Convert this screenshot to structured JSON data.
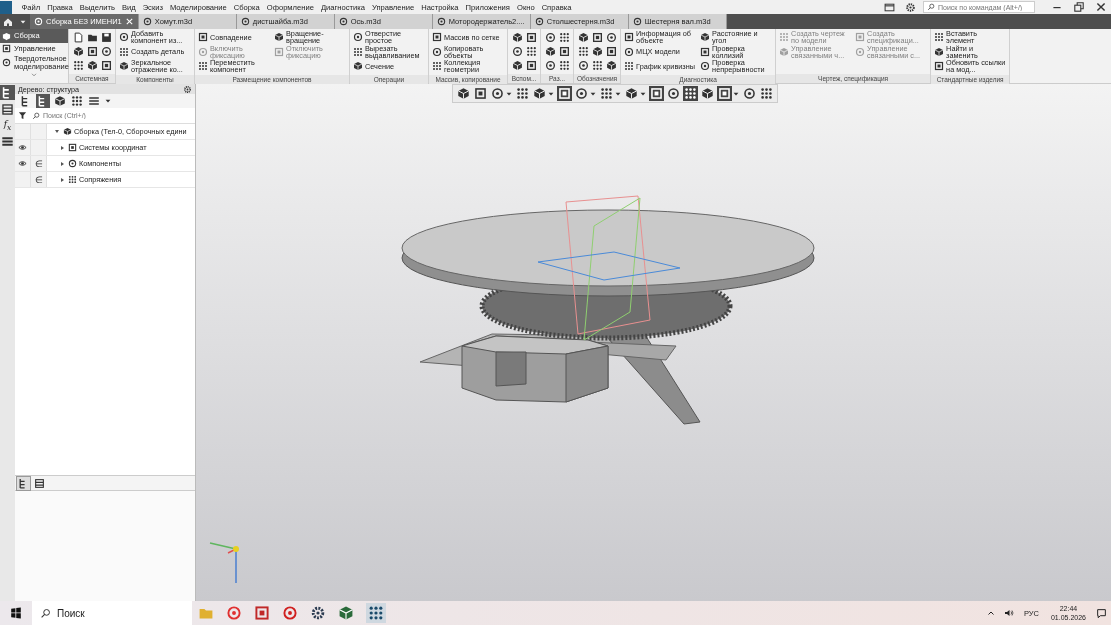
{
  "app_menu": [
    "Файл",
    "Правка",
    "Выделить",
    "Вид",
    "Эскиз",
    "Моделирование",
    "Сборка",
    "Оформление",
    "Диагностика",
    "Управление",
    "Настройка",
    "Приложения",
    "Окно",
    "Справка"
  ],
  "command_search": {
    "placeholder": "Поиск по командам (Alt+/)"
  },
  "document_tabs": [
    {
      "label": "Сборка БЕЗ ИМЕНИ1",
      "selected": true
    },
    {
      "label": "Хомут.m3d",
      "selected": false
    },
    {
      "label": "дистшайба.m3d",
      "selected": false
    },
    {
      "label": "Ось.m3d",
      "selected": false
    },
    {
      "label": "Мотородержатель2....",
      "selected": false
    },
    {
      "label": "Столшестерня.m3d",
      "selected": false
    },
    {
      "label": "Шестерня вал.m3d",
      "selected": false
    }
  ],
  "ribbon": {
    "modes": [
      {
        "label": "Сборка",
        "selected": true
      },
      {
        "label": "Управление",
        "selected": false
      },
      {
        "label": "Твердотельное моделирование",
        "selected": false
      }
    ],
    "groups": [
      {
        "title": "Системная",
        "kind": "icons"
      },
      {
        "title": "Компоненты",
        "kind": "labeled",
        "columns": [
          [
            {
              "label": "Добавить компонент из...",
              "disabled": false
            },
            {
              "label": "Создать деталь",
              "disabled": false
            },
            {
              "label": "Зеркальное отражение ко...",
              "disabled": false
            }
          ]
        ]
      },
      {
        "title": "Размещение компонентов",
        "kind": "labeled",
        "columns": [
          [
            {
              "label": "Совпадение",
              "disabled": false
            },
            {
              "label": "Включить фиксацию",
              "disabled": true
            },
            {
              "label": "Переместить компонент",
              "disabled": false
            }
          ],
          [
            {
              "label": "Вращение-вращение",
              "disabled": false
            },
            {
              "label": "Отключить фиксацию",
              "disabled": true
            }
          ]
        ]
      },
      {
        "title": "Операции",
        "kind": "labeled",
        "columns": [
          [
            {
              "label": "Отверстие простое",
              "disabled": false
            },
            {
              "label": "Вырезать выдавливанием",
              "disabled": false
            },
            {
              "label": "Сечение",
              "disabled": false
            }
          ]
        ]
      },
      {
        "title": "Массив, копирование",
        "kind": "labeled",
        "columns": [
          [
            {
              "label": "Массив по сетке",
              "disabled": false
            },
            {
              "label": "Копировать объекты",
              "disabled": false
            },
            {
              "label": "Коллекция геометрии",
              "disabled": false
            }
          ]
        ]
      },
      {
        "title": "Вспом...",
        "kind": "icons"
      },
      {
        "title": "Раз...",
        "kind": "icons"
      },
      {
        "title": "Обозначения",
        "kind": "icons"
      },
      {
        "title": "Диагностика",
        "kind": "labeled",
        "columns": [
          [
            {
              "label": "Информация об объекте",
              "disabled": false
            },
            {
              "label": "МЦХ модели",
              "disabled": false
            },
            {
              "label": "График кривизны",
              "disabled": false
            }
          ],
          [
            {
              "label": "Расстояние и угол",
              "disabled": false
            },
            {
              "label": "Проверка коллизий",
              "disabled": false
            },
            {
              "label": "Проверка непрерывности",
              "disabled": false
            }
          ]
        ]
      },
      {
        "title": "Чертеж, спецификация",
        "kind": "labeled",
        "columns": [
          [
            {
              "label": "Создать чертеж по модели",
              "disabled": true
            },
            {
              "label": "Управление связанными ч...",
              "disabled": true
            }
          ],
          [
            {
              "label": "Создать спецификаци...",
              "disabled": true
            },
            {
              "label": "Управление связанными с...",
              "disabled": true
            }
          ]
        ]
      },
      {
        "title": "Стандартные изделия",
        "kind": "labeled",
        "columns": [
          [
            {
              "label": "Вставить элемент",
              "disabled": false
            },
            {
              "label": "Найти и заменить",
              "disabled": false
            },
            {
              "label": "Обновить ссылки на мод...",
              "disabled": false
            }
          ]
        ]
      }
    ]
  },
  "side_tabs": [
    {
      "kind": "icon",
      "selected": true
    },
    {
      "kind": "icon",
      "selected": false
    },
    {
      "kind": "text",
      "label": "f$_{x}$",
      "selected": false
    },
    {
      "kind": "icon",
      "selected": false
    }
  ],
  "tree_panel": {
    "title": "Дерево: структура",
    "toolbar": [
      {
        "on": false
      },
      {
        "on": true
      },
      {
        "on": false
      },
      {
        "on": false
      },
      {
        "on": false
      }
    ],
    "search": {
      "placeholder": "Поиск (Ctrl+/)"
    },
    "items": [
      {
        "label": "Сборка (Тел-0, Сборочных едини",
        "expanded": true,
        "visible": false,
        "children": [
          {
            "label": "Системы координат",
            "expanded": false,
            "visible": true
          },
          {
            "label": "Компоненты",
            "expanded": false,
            "visible": true,
            "mark": "∈"
          },
          {
            "label": "Сопряжения",
            "expanded": false,
            "visible": false,
            "mark": "∈"
          }
        ]
      }
    ],
    "bottom_tabs": [
      {
        "selected": true
      },
      {
        "selected": false
      }
    ]
  },
  "view_toolbar": [
    {
      "kind": "button",
      "on": false
    },
    {
      "kind": "button",
      "on": false
    },
    {
      "kind": "dropdown",
      "on": false
    },
    {
      "kind": "button",
      "on": false
    },
    {
      "kind": "dropdown",
      "on": false
    },
    {
      "kind": "button",
      "on": true
    },
    {
      "kind": "dropdown",
      "on": false
    },
    {
      "kind": "dropdown",
      "on": false
    },
    {
      "kind": "dropdown",
      "on": false
    },
    {
      "kind": "button",
      "on": true
    },
    {
      "kind": "button",
      "on": false
    },
    {
      "kind": "button",
      "on": true
    },
    {
      "kind": "button",
      "on": false
    },
    {
      "kind": "dropdown",
      "on": true
    },
    {
      "kind": "button",
      "on": false
    },
    {
      "kind": "button",
      "on": false
    }
  ],
  "taskbar": {
    "search": {
      "placeholder": "Поиск"
    },
    "language": "РУС",
    "time": "22:44",
    "date": "01.05.2026"
  }
}
